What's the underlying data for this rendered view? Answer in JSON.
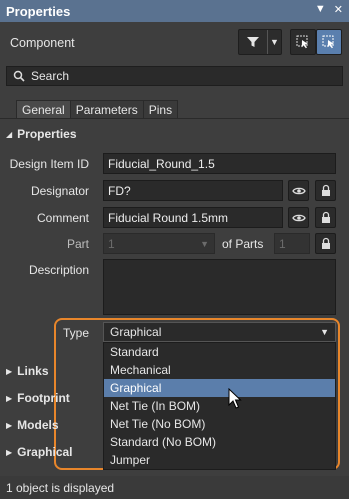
{
  "panel": {
    "title": "Properties"
  },
  "header": {
    "component_label": "Component"
  },
  "search": {
    "label": "Search"
  },
  "tabs": [
    "General",
    "Parameters",
    "Pins"
  ],
  "sections": {
    "properties": "Properties",
    "links": "Links",
    "footprint": "Footprint",
    "models": "Models",
    "graphical": "Graphical"
  },
  "fields": {
    "design_item_id": {
      "label": "Design Item ID",
      "value": "Fiducial_Round_1.5"
    },
    "designator": {
      "label": "Designator",
      "value": "FD?"
    },
    "comment": {
      "label": "Comment",
      "value": "Fiducial Round 1.5mm"
    },
    "part": {
      "label": "Part",
      "value": "1",
      "of_parts_label": "of Parts",
      "of_parts_value": "1"
    },
    "description": {
      "label": "Description",
      "value": ""
    },
    "type": {
      "label": "Type",
      "value": "Graphical"
    }
  },
  "type_options": [
    "Standard",
    "Mechanical",
    "Graphical",
    "Net Tie (In BOM)",
    "Net Tie (No BOM)",
    "Standard (No BOM)",
    "Jumper"
  ],
  "type_selected": "Graphical",
  "status": {
    "text": "1 object is displayed"
  },
  "colors": {
    "accent": "#5b7eab",
    "highlight": "#e8862b",
    "titlebar": "#5a7290"
  }
}
